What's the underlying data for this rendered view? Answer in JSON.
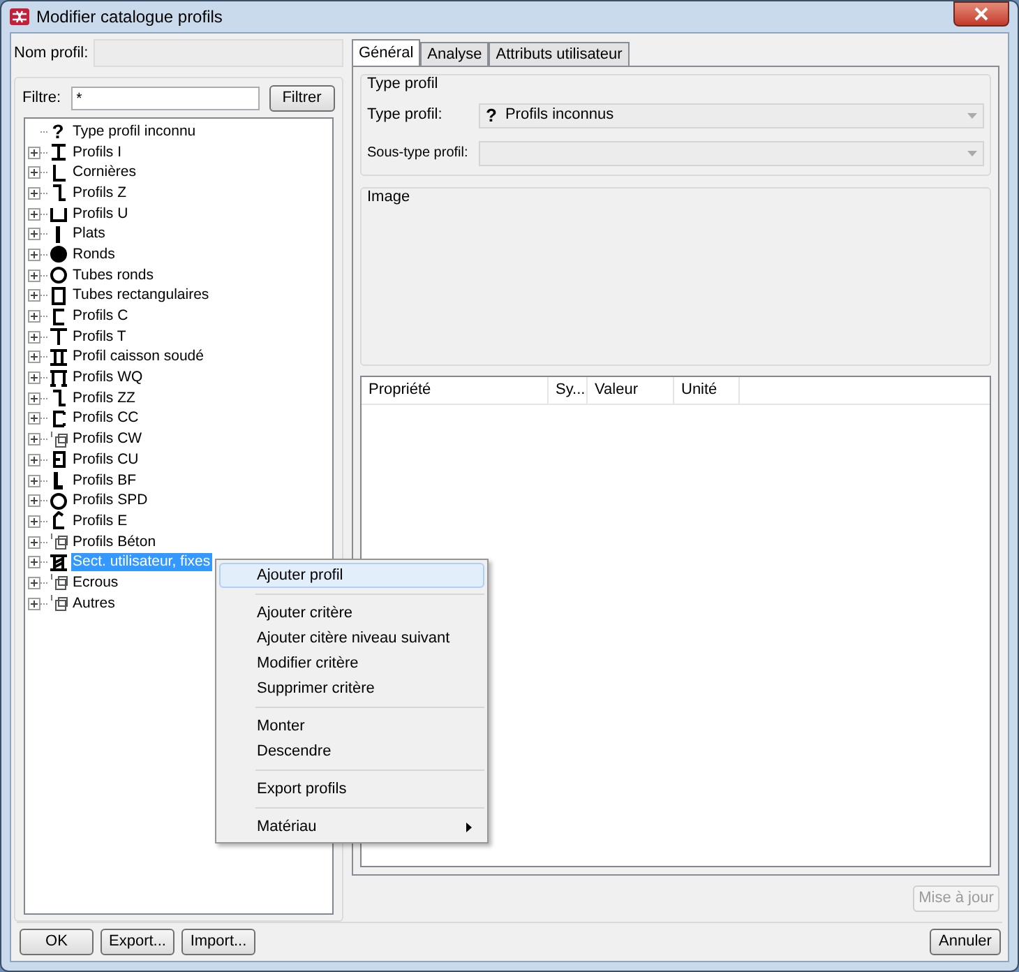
{
  "window": {
    "title": "Modifier catalogue profils"
  },
  "name_field": {
    "label": "Nom profil:",
    "disabled": true
  },
  "filter": {
    "label": "Filtre:",
    "value": "*",
    "button": "Filtrer"
  },
  "tree": [
    {
      "label": "Type profil inconnu",
      "kind": "unknown",
      "icon_text": "?",
      "expandable": false,
      "selected": false
    },
    {
      "label": "Profils I",
      "kind": "i",
      "expandable": true,
      "selected": false
    },
    {
      "label": "Cornières",
      "kind": "l",
      "expandable": true,
      "selected": false
    },
    {
      "label": "Profils Z",
      "kind": "z",
      "expandable": true,
      "selected": false
    },
    {
      "label": "Profils U",
      "kind": "u",
      "expandable": true,
      "selected": false
    },
    {
      "label": "Plats",
      "kind": "flat",
      "expandable": true,
      "selected": false
    },
    {
      "label": "Ronds",
      "kind": "round",
      "expandable": true,
      "selected": false
    },
    {
      "label": "Tubes ronds",
      "kind": "tube",
      "expandable": true,
      "selected": false
    },
    {
      "label": "Tubes rectangulaires",
      "kind": "rect",
      "expandable": true,
      "selected": false
    },
    {
      "label": "Profils C",
      "kind": "c",
      "expandable": true,
      "selected": false
    },
    {
      "label": "Profils T",
      "kind": "t",
      "expandable": true,
      "selected": false
    },
    {
      "label": "Profil caisson soudé",
      "kind": "box",
      "expandable": true,
      "selected": false
    },
    {
      "label": "Profils WQ",
      "kind": "wq",
      "expandable": true,
      "selected": false
    },
    {
      "label": "Profils ZZ",
      "kind": "z",
      "expandable": true,
      "selected": false
    },
    {
      "label": "Profils CC",
      "kind": "cc",
      "expandable": true,
      "selected": false
    },
    {
      "label": "Profils CW",
      "kind": "param",
      "expandable": true,
      "selected": false
    },
    {
      "label": "Profils CU",
      "kind": "cu",
      "expandable": true,
      "selected": false
    },
    {
      "label": "Profils BF",
      "kind": "bf",
      "expandable": true,
      "selected": false
    },
    {
      "label": "Profils SPD",
      "kind": "tube",
      "expandable": true,
      "selected": false
    },
    {
      "label": "Profils E",
      "kind": "e",
      "expandable": true,
      "selected": false
    },
    {
      "label": "Profils Béton",
      "kind": "param",
      "expandable": true,
      "selected": false
    },
    {
      "label": "Sect. utilisateur, fixes",
      "kind": "user",
      "expandable": true,
      "selected": true
    },
    {
      "label": "Ecrous",
      "kind": "param",
      "expandable": true,
      "selected": false
    },
    {
      "label": "Autres",
      "kind": "param",
      "expandable": true,
      "selected": false
    }
  ],
  "tabs": [
    {
      "label": "Général",
      "selected": true
    },
    {
      "label": "Analyse",
      "selected": false
    },
    {
      "label": "Attributs utilisateur",
      "selected": false
    }
  ],
  "type_group": {
    "title": "Type profil",
    "type_label": "Type profil:",
    "type_icon": "?",
    "type_value": "Profils inconnus",
    "subtype_label": "Sous-type profil:"
  },
  "image_group": {
    "title": "Image"
  },
  "table": {
    "columns": [
      "Propriété",
      "Sy...",
      "Valeur",
      "Unité"
    ]
  },
  "update_button": {
    "label": "Mise à jour",
    "disabled": true
  },
  "buttons": [
    "OK",
    "Export...",
    "Import..."
  ],
  "cancel_button": "Annuler",
  "context_menu": [
    {
      "kind": "item",
      "label": "Ajouter profil",
      "selected": true
    },
    {
      "kind": "separator"
    },
    {
      "kind": "item",
      "label": "Ajouter critère",
      "selected": false
    },
    {
      "kind": "item",
      "label": "Ajouter citère niveau suivant",
      "selected": false
    },
    {
      "kind": "item",
      "label": "Modifier critère",
      "selected": false
    },
    {
      "kind": "item",
      "label": "Supprimer critère",
      "selected": false
    },
    {
      "kind": "separator"
    },
    {
      "kind": "item",
      "label": "Monter",
      "selected": false
    },
    {
      "kind": "item",
      "label": "Descendre",
      "selected": false
    },
    {
      "kind": "separator"
    },
    {
      "kind": "item",
      "label": "Export profils",
      "selected": false
    },
    {
      "kind": "separator"
    },
    {
      "kind": "submenu",
      "label": "Matériau",
      "selected": false
    }
  ]
}
